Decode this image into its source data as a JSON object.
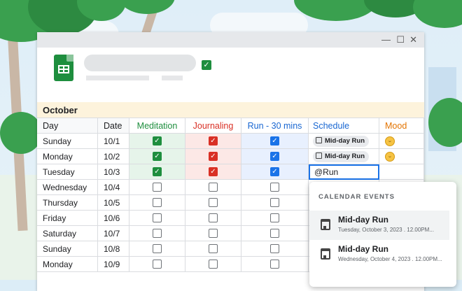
{
  "window": {
    "minimize": "—",
    "maximize": "☐",
    "close": "✕"
  },
  "sheet": {
    "month": "October",
    "headers": {
      "day": "Day",
      "date": "Date",
      "meditation": "Meditation",
      "journaling": "Journaling",
      "run": "Run - 30 mins",
      "schedule": "Schedule",
      "mood": "Mood"
    },
    "rows": [
      {
        "day": "Sunday",
        "date": "10/1",
        "meditation": true,
        "journaling": true,
        "run": true,
        "schedule": "Mid-day Run",
        "mood": "smiling-face"
      },
      {
        "day": "Monday",
        "date": "10/2",
        "meditation": true,
        "journaling": true,
        "run": true,
        "schedule": "Mid-day Run",
        "mood": "smiling-face"
      },
      {
        "day": "Tuesday",
        "date": "10/3",
        "meditation": true,
        "journaling": true,
        "run": true,
        "schedule_input": "@Run"
      },
      {
        "day": "Wednesday",
        "date": "10/4",
        "meditation": false,
        "journaling": false,
        "run": false
      },
      {
        "day": "Thursday",
        "date": "10/5",
        "meditation": false,
        "journaling": false,
        "run": false
      },
      {
        "day": "Friday",
        "date": "10/6",
        "meditation": false,
        "journaling": false,
        "run": false
      },
      {
        "day": "Saturday",
        "date": "10/7",
        "meditation": false,
        "journaling": false,
        "run": false
      },
      {
        "day": "Sunday",
        "date": "10/8",
        "meditation": false,
        "journaling": false,
        "run": false
      },
      {
        "day": "Monday",
        "date": "10/9",
        "meditation": false,
        "journaling": false,
        "run": false
      }
    ]
  },
  "popup": {
    "title": "CALENDAR EVENTS",
    "events": [
      {
        "title": "Mid-day Run",
        "subtitle": "Tuesday, October 3, 2023 . 12.00PM..."
      },
      {
        "title": "Mid-day Run",
        "subtitle": "Wednesday, October 4, 2023 . 12.00PM..."
      }
    ]
  },
  "colors": {
    "green": "#1e8e3e",
    "red": "#d93025",
    "blue": "#1a73e8",
    "orange": "#e37400",
    "month_band": "#fdf3dc"
  }
}
